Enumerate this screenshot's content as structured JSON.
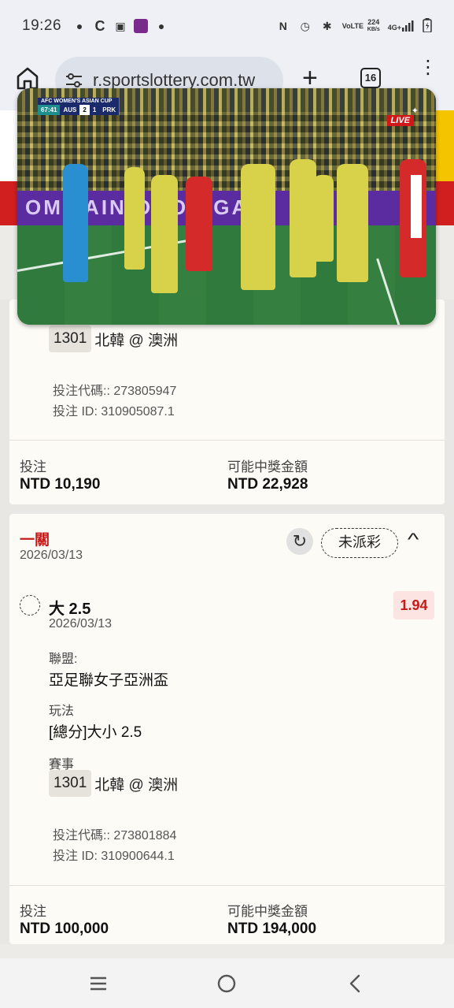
{
  "status_bar": {
    "time": "19:26",
    "left_icons": [
      "chat-icon",
      "c-app-icon",
      "shopping-bag-icon",
      "game-avatar-icon",
      "line-icon"
    ],
    "right_icons": [
      "nfc-icon",
      "alarm-icon",
      "bluetooth-icon",
      "volte-icon",
      "data-speed-icon",
      "signal-icon",
      "battery-icon"
    ],
    "volte": "VoLTE",
    "speed_value": "224",
    "speed_unit": "KB/s",
    "network": "4G+"
  },
  "browser": {
    "url": "r.sportslottery.com.tw",
    "tab_count": "16"
  },
  "video": {
    "competition": "AFC WOMEN'S ASIAN CUP",
    "clock": "67:41",
    "home_team": "AUS",
    "home_score": "2",
    "away_score": "1",
    "away_team": "PRK",
    "live_label": "LIVE",
    "board_text": "OM TAIN  ORON  GAMI"
  },
  "bet1": {
    "match_code": "1301",
    "match": "北韓 @ 澳洲",
    "bet_code": "投注代碼:: 273805947",
    "bet_id": "投注 ID: 310905087.1",
    "stake_label": "投注",
    "stake_value": "NTD 10,190",
    "payout_label": "可能中獎金額",
    "payout_value": "NTD 22,928"
  },
  "bet2": {
    "type": "一關",
    "date": "2026/03/13",
    "status": "未派彩",
    "selection": "大 2.5",
    "selection_date": "2026/03/13",
    "odds": "1.94",
    "league_label": "聯盟:",
    "league": "亞足聯女子亞洲盃",
    "market_label": "玩法",
    "market": "[總分]大小 2.5",
    "event_label": "賽事",
    "match_code": "1301",
    "match": "北韓 @ 澳洲",
    "bet_code": "投注代碼:: 273801884",
    "bet_id": "投注 ID: 310900644.1",
    "stake_label": "投注",
    "stake_value": "NTD 100,000",
    "payout_label": "可能中獎金額",
    "payout_value": "NTD 194,000"
  },
  "colors": {
    "accent_red": "#c41a1a",
    "band_red": "#d11f1f",
    "odds_bg": "#fbe4e2",
    "card_bg": "#fdfbf5"
  }
}
